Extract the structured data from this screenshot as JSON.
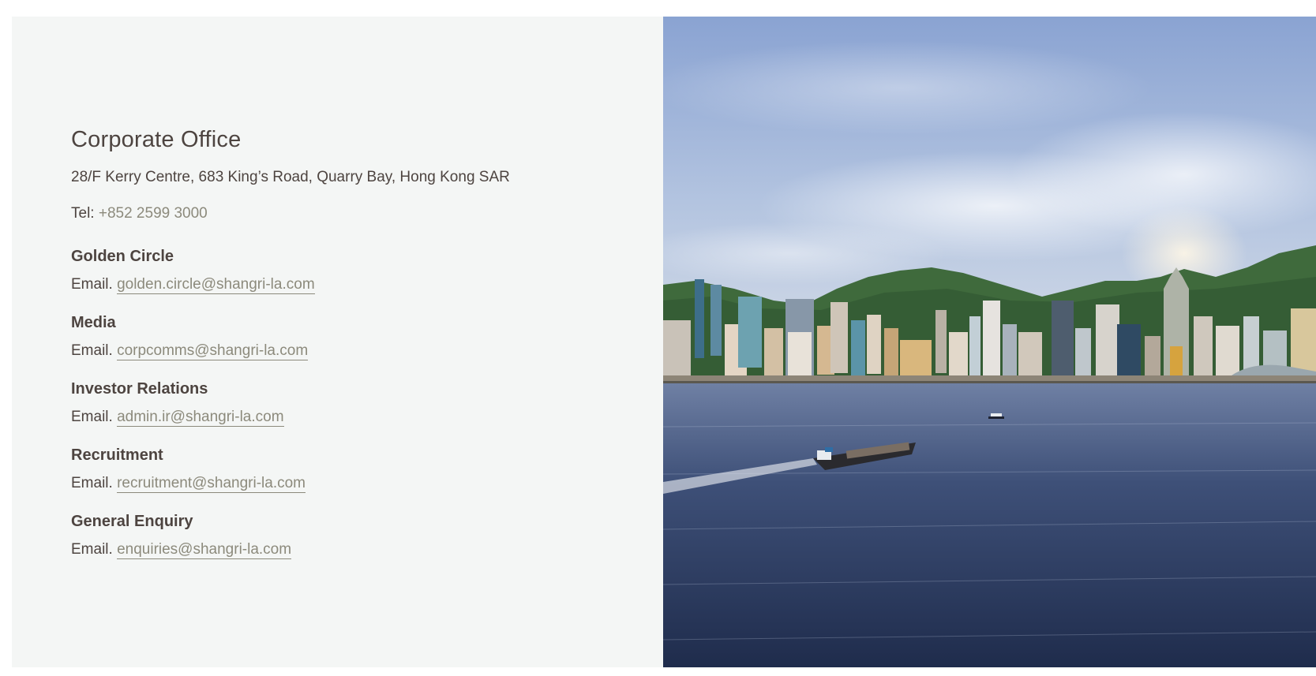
{
  "office": {
    "title": "Corporate Office",
    "address": "28/F Kerry Centre, 683 King’s Road, Quarry Bay, Hong Kong SAR",
    "tel_label": "Tel: ",
    "tel_value": "+852 2599 3000"
  },
  "contacts": [
    {
      "title": "Golden Circle",
      "email_label": "Email. ",
      "email": "golden.circle@shangri-la.com"
    },
    {
      "title": "Media",
      "email_label": "Email. ",
      "email": "corpcomms@shangri-la.com"
    },
    {
      "title": "Investor Relations",
      "email_label": "Email. ",
      "email": "admin.ir@shangri-la.com"
    },
    {
      "title": "Recruitment",
      "email_label": "Email. ",
      "email": "recruitment@shangri-la.com"
    },
    {
      "title": "General Enquiry",
      "email_label": "Email. ",
      "email": "enquiries@shangri-la.com"
    }
  ],
  "colors": {
    "panel_bg": "#f4f6f5",
    "text": "#4d4440",
    "link": "#8c8a7c"
  }
}
